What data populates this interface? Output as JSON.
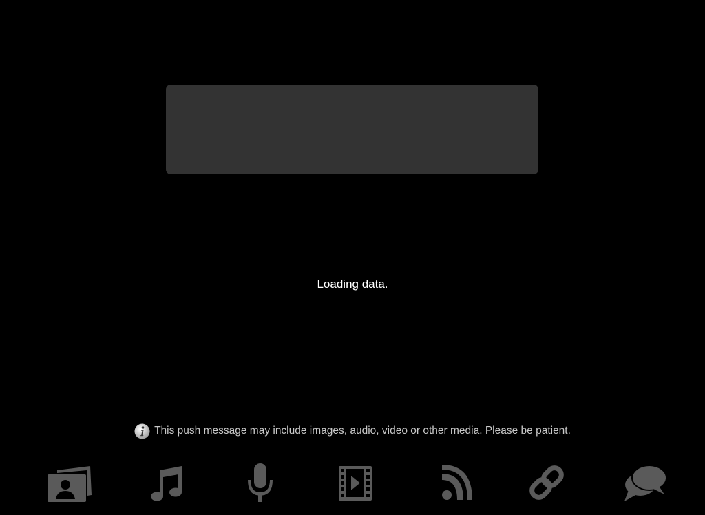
{
  "status": {
    "loading_text": "Loading data."
  },
  "notice": {
    "text": "This push message may include images, audio, video or other media.  Please be patient.",
    "icon": "info-icon"
  },
  "tabbar": {
    "icon_color": "#5a5a5a",
    "items": [
      {
        "name": "photos",
        "icon": "photo-icon"
      },
      {
        "name": "music",
        "icon": "music-note-icon"
      },
      {
        "name": "audio",
        "icon": "microphone-icon"
      },
      {
        "name": "video",
        "icon": "film-icon"
      },
      {
        "name": "rss",
        "icon": "rss-icon"
      },
      {
        "name": "links",
        "icon": "link-icon"
      },
      {
        "name": "chat",
        "icon": "chat-bubbles-icon"
      }
    ]
  },
  "colors": {
    "background": "#000000",
    "panel": "#333333",
    "notice_text": "#c8c8c8",
    "icon": "#5a5a5a"
  }
}
